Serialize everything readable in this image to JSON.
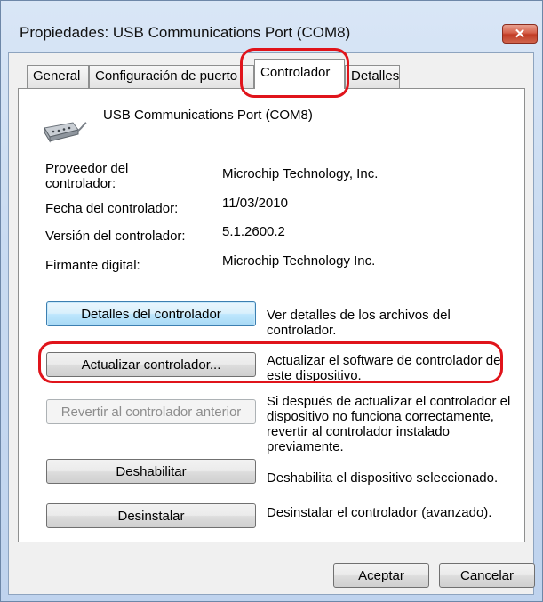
{
  "window": {
    "title": "Propiedades: USB Communications Port (COM8)",
    "close_glyph": "✕"
  },
  "tabs": [
    {
      "label": "General"
    },
    {
      "label": "Configuración de puerto"
    },
    {
      "label": "Controlador",
      "active": true
    },
    {
      "label": "Detalles"
    }
  ],
  "device": {
    "name": "USB Communications Port (COM8)",
    "icon": "serial-port-icon"
  },
  "info": {
    "provider_label": "Proveedor del controlador:",
    "provider_value": "Microchip Technology, Inc.",
    "date_label": "Fecha del controlador:",
    "date_value": "11/03/2010",
    "version_label": "Versión del controlador:",
    "version_value": "5.1.2600.2",
    "signer_label": "Firmante digital:",
    "signer_value": "Microchip Technology Inc."
  },
  "actions": {
    "details_button": "Detalles del controlador",
    "details_desc": "Ver detalles de los archivos del controlador.",
    "update_button": "Actualizar controlador...",
    "update_desc": "Actualizar el software de controlador de este dispositivo.",
    "rollback_button": "Revertir al controlador anterior",
    "rollback_desc": "Si después de actualizar el controlador el dispositivo no funciona correctamente, revertir al controlador instalado previamente.",
    "disable_button": "Deshabilitar",
    "disable_desc": "Deshabilita el dispositivo seleccionado.",
    "uninstall_button": "Desinstalar",
    "uninstall_desc": "Desinstalar el controlador (avanzado)."
  },
  "footer": {
    "ok_button": "Aceptar",
    "cancel_button": "Cancelar"
  },
  "colors": {
    "annotation_red": "#e0141b",
    "focus_blue": "#3c7fb1"
  }
}
